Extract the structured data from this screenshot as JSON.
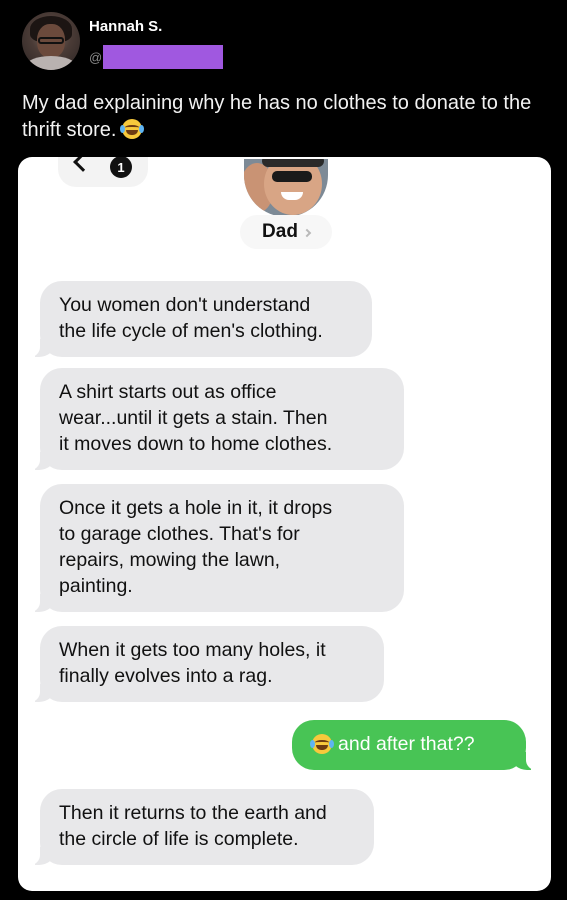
{
  "post": {
    "author_name": "Hannah S.",
    "handle_prefix": "@",
    "text": "My dad explaining why he has no clothes to donate to the thrift store.",
    "text_emoji": "face-with-tears-of-joy"
  },
  "conversation": {
    "back_badge_count": "1",
    "contact_name": "Dad",
    "colors": {
      "incoming_bubble": "#e8e8ea",
      "outgoing_bubble": "#48c455",
      "redaction": "#a058e0"
    },
    "messages": [
      {
        "direction": "incoming",
        "text": "You women don't understand\nthe life cycle of men's clothing."
      },
      {
        "direction": "incoming",
        "text": "A shirt starts out as office\nwear...until it gets a stain. Then\nit moves down to home clothes."
      },
      {
        "direction": "incoming",
        "text": "Once it gets a hole in it, it drops\nto garage clothes. That's for\nrepairs, mowing the lawn,\npainting."
      },
      {
        "direction": "incoming",
        "text": "When it gets too many holes, it\nfinally evolves into a rag."
      },
      {
        "direction": "outgoing",
        "text": "and after that??",
        "emoji": "face-with-tears-of-joy"
      },
      {
        "direction": "incoming",
        "text": "Then it returns to the earth and\nthe circle of life is complete."
      }
    ]
  }
}
